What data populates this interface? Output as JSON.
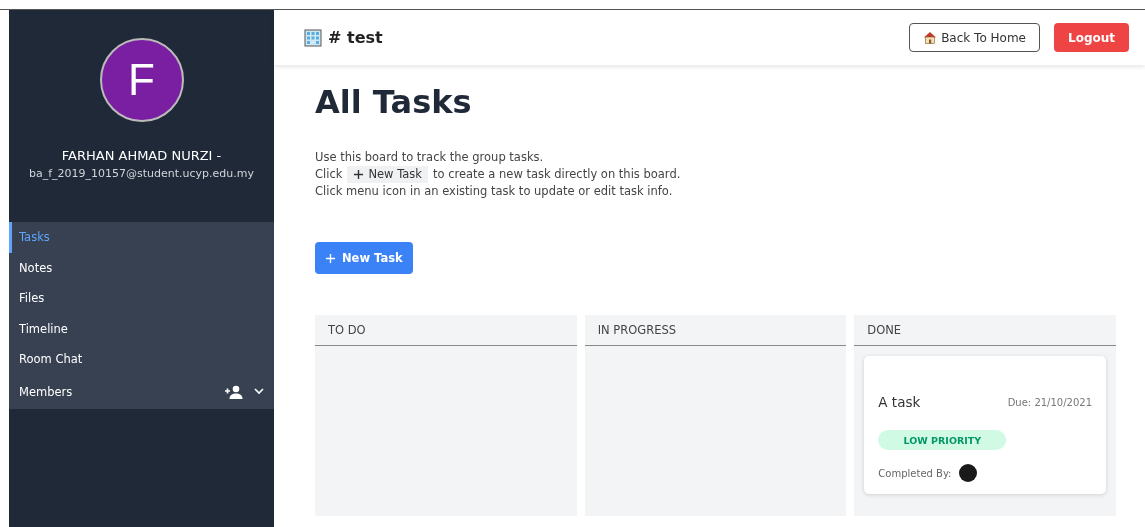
{
  "user": {
    "initial": "F",
    "name": "FARHAN AHMAD NURZI -",
    "email": "ba_f_2019_10157@student.ucyp.edu.my"
  },
  "sidebar": {
    "items": [
      {
        "label": "Tasks",
        "selected": true,
        "kind": "link"
      },
      {
        "label": "Notes",
        "selected": false,
        "kind": "link"
      },
      {
        "label": "Files",
        "selected": false,
        "kind": "link"
      },
      {
        "label": "Timeline",
        "selected": false,
        "kind": "link"
      },
      {
        "label": "Room Chat",
        "selected": false,
        "kind": "link"
      },
      {
        "label": "Members",
        "selected": false,
        "kind": "members"
      }
    ]
  },
  "header": {
    "room": "# test",
    "back_button": "Back To Home",
    "logout_button": "Logout"
  },
  "page": {
    "title": "All Tasks",
    "intro": "Use this board to track the group tasks.",
    "click_before": "Click",
    "chip": "New Task",
    "click_after": "to create a new task directly on this board.",
    "menu_hint": "Click menu icon in an existing task to update or edit task info.",
    "new_task_button": "New Task"
  },
  "board": {
    "columns": [
      {
        "title": "TO DO"
      },
      {
        "title": "IN PROGRESS"
      },
      {
        "title": "DONE",
        "tasks": [
          {
            "title": "A task",
            "due": "Due: 21/10/2021",
            "priority": "LOW PRIORITY",
            "completed_label": "Completed By:"
          }
        ]
      }
    ]
  }
}
